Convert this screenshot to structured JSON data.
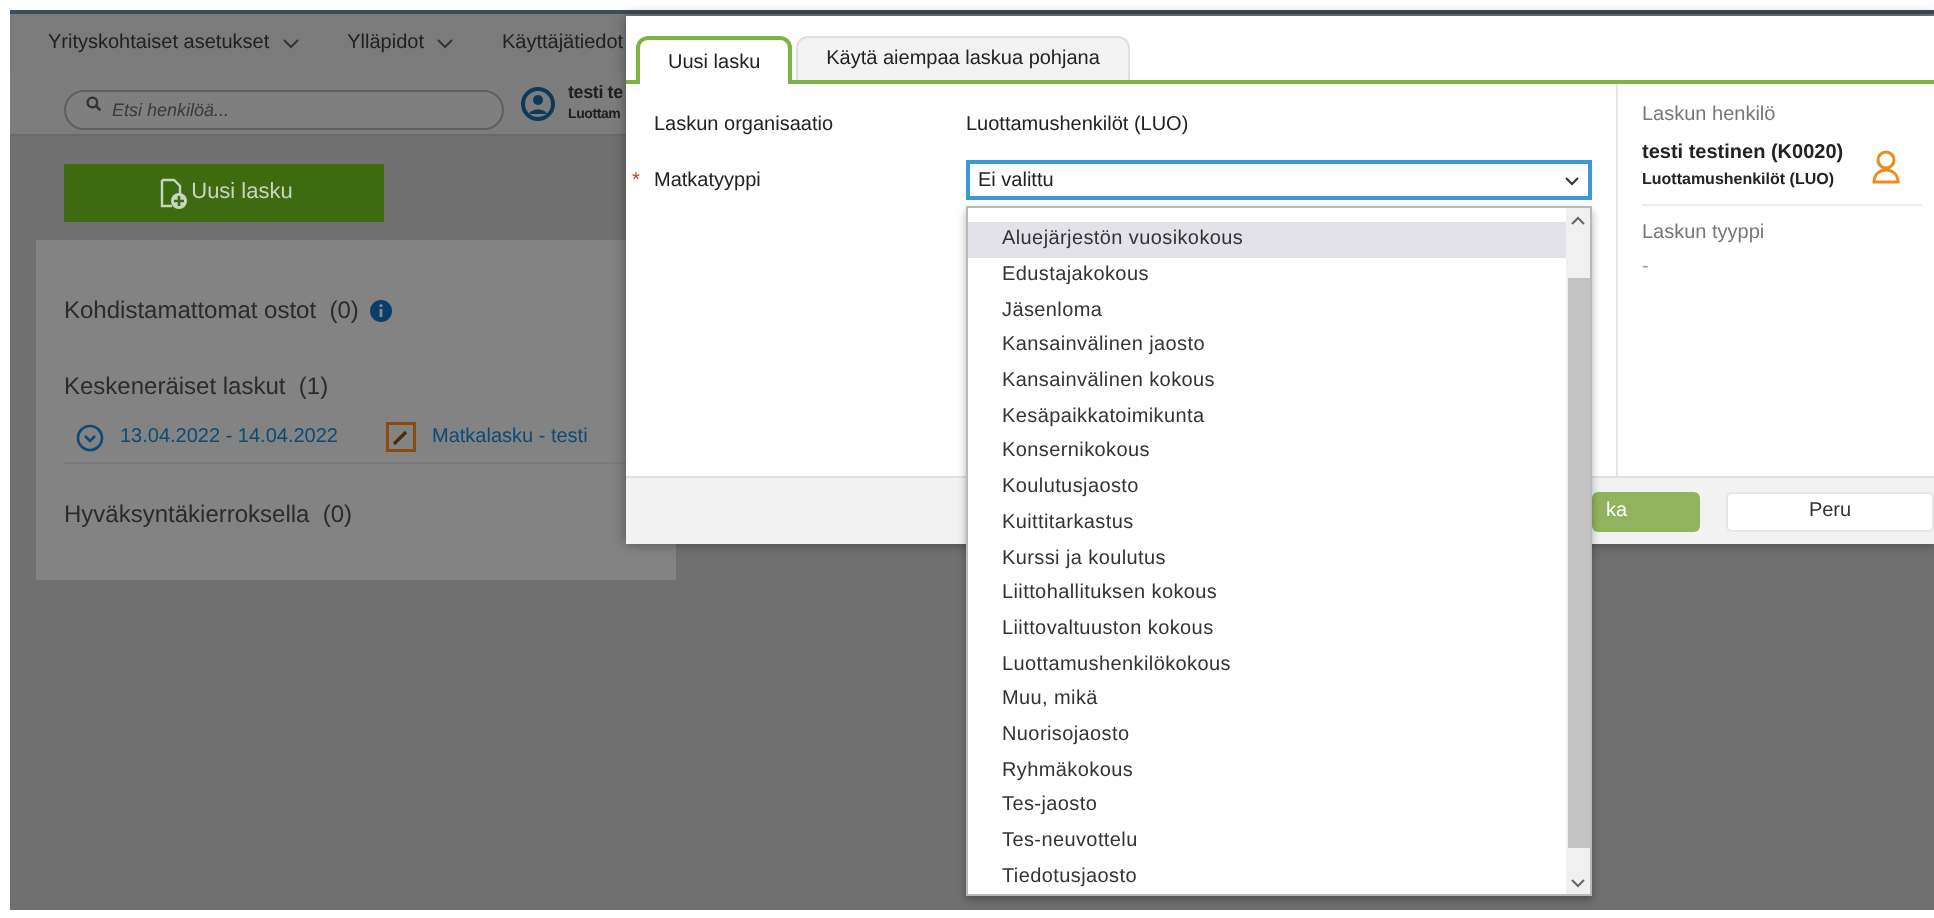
{
  "nav": [
    {
      "label": "Yrityskohtaiset asetukset",
      "dropdown": true
    },
    {
      "label": "Ylläpidot",
      "dropdown": true
    },
    {
      "label": "Käyttäjätiedot",
      "dropdown": false
    }
  ],
  "search": {
    "placeholder": "Etsi henkilöä..."
  },
  "user": {
    "name": "testi te",
    "org": "Luottam"
  },
  "new_invoice_button": "Uusi lasku",
  "sections": [
    {
      "title": "Kohdistamattomat ostot",
      "count": "(0)",
      "info": true
    },
    {
      "title": "Keskeneräiset laskut",
      "count": "(1)",
      "info": false,
      "invoices": [
        {
          "dates": "13.04.2022 - 14.04.2022",
          "name": "Matkalasku - testi"
        }
      ]
    },
    {
      "title": "Hyväksyntäkierroksella",
      "count": "(0)",
      "info": false
    }
  ],
  "dialog": {
    "tabs": [
      {
        "label": "Uusi lasku",
        "selected": true
      },
      {
        "label": "Käytä aiempaa laskua pohjana",
        "selected": false
      }
    ],
    "required_mark": "*",
    "fields": [
      {
        "label": "Laskun organisaatio",
        "required": false,
        "kind": "text",
        "value": "Luottamushenkilöt (LUO)"
      },
      {
        "label": "Matkatyyppi",
        "required": true,
        "kind": "select",
        "value": "Ei valittu"
      }
    ],
    "side": {
      "person_label": "Laskun henkilö",
      "person_name": "testi testinen (K0020)",
      "person_org": "Luottamushenkilöt (LUO)",
      "type_label": "Laskun tyyppi",
      "type_value": "-"
    },
    "buttons": [
      {
        "label": "ka",
        "kind": "primary"
      },
      {
        "label": "Peru",
        "kind": "secondary"
      }
    ]
  },
  "dropdown": {
    "options": [
      {
        "label": "Aluejärjestön vuosikokous",
        "selected": true
      },
      {
        "label": "Edustajakokous",
        "selected": false
      },
      {
        "label": "Jäsenloma",
        "selected": false
      },
      {
        "label": "Kansainvälinen jaosto",
        "selected": false
      },
      {
        "label": "Kansainvälinen kokous",
        "selected": false
      },
      {
        "label": "Kesäpaikkatoimikunta",
        "selected": false
      },
      {
        "label": "Konsernikokous",
        "selected": false
      },
      {
        "label": "Koulutusjaosto",
        "selected": false
      },
      {
        "label": "Kuittitarkastus",
        "selected": false
      },
      {
        "label": "Kurssi ja koulutus",
        "selected": false
      },
      {
        "label": "Liittohallituksen kokous",
        "selected": false
      },
      {
        "label": "Liittovaltuuston kokous",
        "selected": false
      },
      {
        "label": "Luottamushenkilökokous",
        "selected": false
      },
      {
        "label": "Muu, mikä",
        "selected": false
      },
      {
        "label": "Nuorisojaosto",
        "selected": false
      },
      {
        "label": "Ryhmäkokous",
        "selected": false
      },
      {
        "label": "Tes-jaosto",
        "selected": false
      },
      {
        "label": "Tes-neuvottelu",
        "selected": false
      },
      {
        "label": "Tiedotusjaosto",
        "selected": false
      }
    ]
  }
}
